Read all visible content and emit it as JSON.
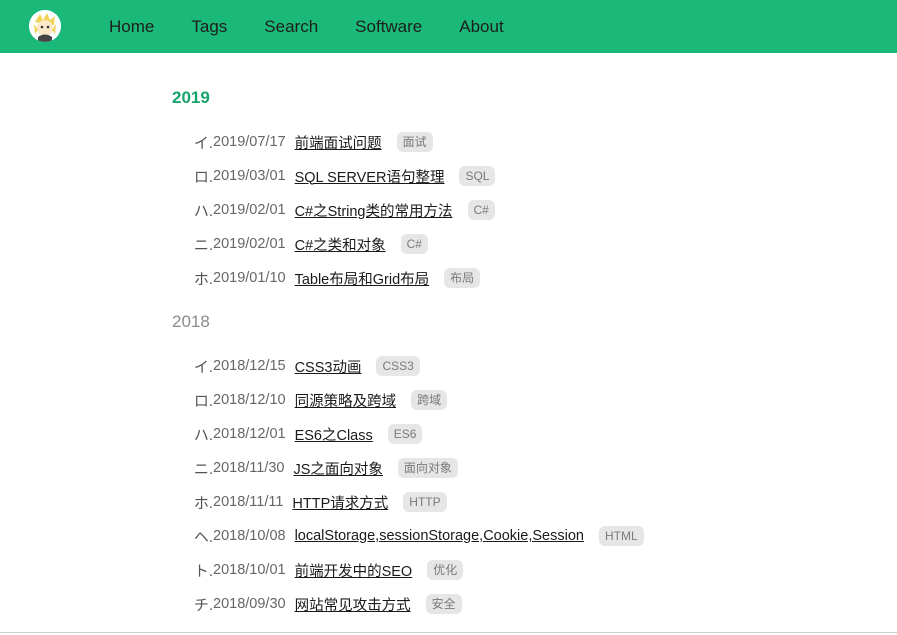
{
  "nav": {
    "logo_alt": "avatar",
    "links": [
      "Home",
      "Tags",
      "Search",
      "Software",
      "About"
    ]
  },
  "archive": [
    {
      "year": "2019",
      "posts": [
        {
          "marker": "イ.",
          "date": "2019/07/17",
          "title": "前端面试问题",
          "tag": "面试"
        },
        {
          "marker": "ロ.",
          "date": "2019/03/01",
          "title": "SQL SERVER语句整理",
          "tag": "SQL"
        },
        {
          "marker": "ハ.",
          "date": "2019/02/01",
          "title": "C#之String类的常用方法",
          "tag": "C#"
        },
        {
          "marker": "ニ.",
          "date": "2019/02/01",
          "title": "C#之类和对象",
          "tag": "C#"
        },
        {
          "marker": "ホ.",
          "date": "2019/01/10",
          "title": "Table布局和Grid布局",
          "tag": "布局"
        }
      ]
    },
    {
      "year": "2018",
      "posts": [
        {
          "marker": "イ.",
          "date": "2018/12/15",
          "title": "CSS3动画",
          "tag": "CSS3"
        },
        {
          "marker": "ロ.",
          "date": "2018/12/10",
          "title": "同源策略及跨域",
          "tag": "跨域"
        },
        {
          "marker": "ハ.",
          "date": "2018/12/01",
          "title": "ES6之Class",
          "tag": "ES6"
        },
        {
          "marker": "ニ.",
          "date": "2018/11/30",
          "title": "JS之面向对象",
          "tag": "面向对象"
        },
        {
          "marker": "ホ.",
          "date": "2018/11/11",
          "title": "HTTP请求方式",
          "tag": "HTTP"
        },
        {
          "marker": "ヘ.",
          "date": "2018/10/08",
          "title": "localStorage,sessionStorage,Cookie,Session",
          "tag": "HTML"
        },
        {
          "marker": "ト.",
          "date": "2018/10/01",
          "title": "前端开发中的SEO",
          "tag": "优化"
        },
        {
          "marker": "チ.",
          "date": "2018/09/30",
          "title": "网站常见攻击方式",
          "tag": "安全"
        }
      ]
    }
  ],
  "colors": {
    "navbar_bg": "#1ab97a",
    "active_year": "#16a46c",
    "muted_year": "#8c8c8c",
    "tag_bg": "#e6e6e6"
  }
}
